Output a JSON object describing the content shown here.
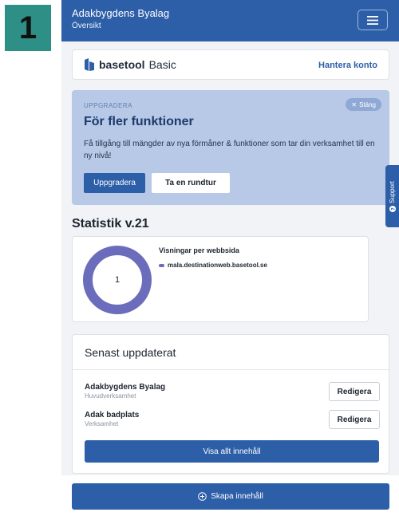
{
  "step_badge": "1",
  "header": {
    "org_name": "Adakbygdens Byalag",
    "page_name": "Översikt"
  },
  "brand": {
    "logo_text": "basetool",
    "plan": "Basic",
    "manage_link": "Hantera konto"
  },
  "upgrade_banner": {
    "eyebrow": "UPPGRADERA",
    "title": "För fler funktioner",
    "description": "Få tillgång till mängder av nya förmåner & funktioner som tar din verksamhet till en ny nivå!",
    "close_label": "Stäng",
    "upgrade_button": "Uppgradera",
    "tour_button": "Ta en rundtur"
  },
  "support_tab": {
    "label": "Support"
  },
  "statistics": {
    "title": "Statistik v.21"
  },
  "chart_data": {
    "type": "pie",
    "title": "Visningar per webbsida",
    "center_label": "1",
    "slices": [
      {
        "label": "mala.destinationweb.basetool.se",
        "value": 1,
        "color": "#6b6cbc"
      }
    ]
  },
  "recent": {
    "title": "Senast uppdaterat",
    "items": [
      {
        "name": "Adakbygdens Byalag",
        "type": "Huvudverksamhet",
        "action": "Redigera"
      },
      {
        "name": "Adak badplats",
        "type": "Verksamhet",
        "action": "Redigera"
      }
    ],
    "show_all": "Visa allt innehåll"
  },
  "create_button": {
    "label": "Skapa innehåll"
  },
  "colors": {
    "primary": "#2d5ea8",
    "banner": "#b7c9e6",
    "chart": "#6b6cbc",
    "badge": "#2d8f85"
  }
}
